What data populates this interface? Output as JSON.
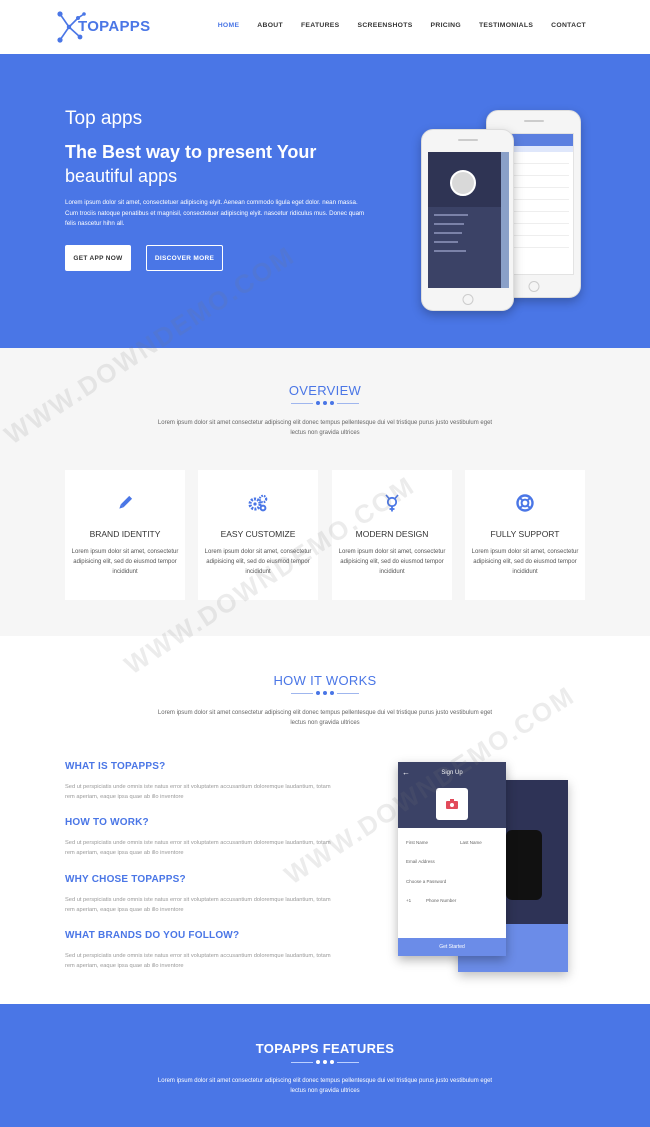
{
  "nav": {
    "logo_text": "TOPAPPS",
    "items": [
      {
        "label": "HOME",
        "active": true
      },
      {
        "label": "ABOUT",
        "active": false
      },
      {
        "label": "FEATURES",
        "active": false
      },
      {
        "label": "SCREENSHOTS",
        "active": false
      },
      {
        "label": "PRICING",
        "active": false
      },
      {
        "label": "TESTIMONIALS",
        "active": false
      },
      {
        "label": "CONTACT",
        "active": false
      }
    ]
  },
  "hero": {
    "kicker": "Top apps",
    "title_line1": "The Best way to present Your",
    "title_line2": "beautiful apps",
    "description": "Lorem ipsum dolor sit amet, consectetuer adipiscing elyit. Aenean commodo ligula eget dolor. nean massa. Cum trociis natoque penatibus et magnisil, consectetuer adipiscing elyit. nascetur ridiculus mus. Donec quam felis nascetur hihn all.",
    "primary_button": "GET APP NOW",
    "secondary_button": "DISCOVER MORE"
  },
  "overview": {
    "title": "OVERVIEW",
    "description": "Lorem ipsum dolor sit amet consectetur adipiscing elit donec tempus pellentesque dui vel tristique purus justo vestibulum eget lectus non gravida ultrices",
    "cards": [
      {
        "title": "BRAND IDENTITY",
        "text": "Lorem ipsum dolor sit amet, consectetur adipisicing elit, sed do eiusmod tempor incididunt",
        "icon": "pencil-icon"
      },
      {
        "title": "EASY CUSTOMIZE",
        "text": "Lorem ipsum dolor sit amet, consectetur adipisicing elit, sed do eiusmod tempor incididunt",
        "icon": "gears-icon"
      },
      {
        "title": "MODERN DESIGN",
        "text": "Lorem ipsum dolor sit amet, consectetur adipisicing elit, sed do eiusmod tempor incididunt",
        "icon": "gender-symbol-icon"
      },
      {
        "title": "FULLY SUPPORT",
        "text": "Lorem ipsum dolor sit amet, consectetur adipisicing elit, sed do eiusmod tempor incididunt",
        "icon": "lifebuoy-icon"
      }
    ]
  },
  "how": {
    "title": "HOW IT WORKS",
    "description": "Lorem ipsum dolor sit amet consectetur adipiscing elit donec tempus pellentesque dui vel tristique purus justo vestibulum eget lectus non gravida ultrices",
    "items": [
      {
        "title": "WHAT IS TOPAPPS?",
        "text": "Sed ut perspiciatis unde omnis iste natus error sit voluptatem accusantium doloremque laudantium, totam rem aperiam, eaque ipsa quae ab illo inventore"
      },
      {
        "title": "HOW TO WORK?",
        "text": "Sed ut perspiciatis unde omnis iste natus error sit voluptatem accusantium doloremque laudantium, totam rem aperiam, eaque ipsa quae ab illo inventore"
      },
      {
        "title": "WHY CHOSE TOPAPPS?",
        "text": "Sed ut perspiciatis unde omnis iste natus error sit voluptatem accusantium doloremque laudantium, totam rem aperiam, eaque ipsa quae ab illo inventore"
      },
      {
        "title": "WHAT BRANDS DO YOU FOLLOW?",
        "text": "Sed ut perspiciatis unde omnis iste natus error sit voluptatem accusantium doloremque laudantium, totam rem aperiam, eaque ipsa quae ab illo inventore"
      }
    ],
    "phone": {
      "header": "Sign Up",
      "field_first": "First Name",
      "field_last": "Last Name",
      "field_email": "Email Address",
      "field_password": "Choose a Password",
      "field_phone_code": "+1",
      "field_phone": "Phone Number",
      "button": "Get Started"
    }
  },
  "features": {
    "title": "TOPAPPS FEATURES",
    "description": "Lorem ipsum dolor sit amet consectetur adipiscing elit donec tempus pellentesque dui vel tristique purus justo vestibulum eget lectus non gravida ultrices"
  },
  "watermark": "WWW.DOWNDEMO.COM",
  "colors": {
    "accent": "#4a76e6",
    "light_bg": "#f6f6f6",
    "dark_phone": "#3b4266"
  }
}
